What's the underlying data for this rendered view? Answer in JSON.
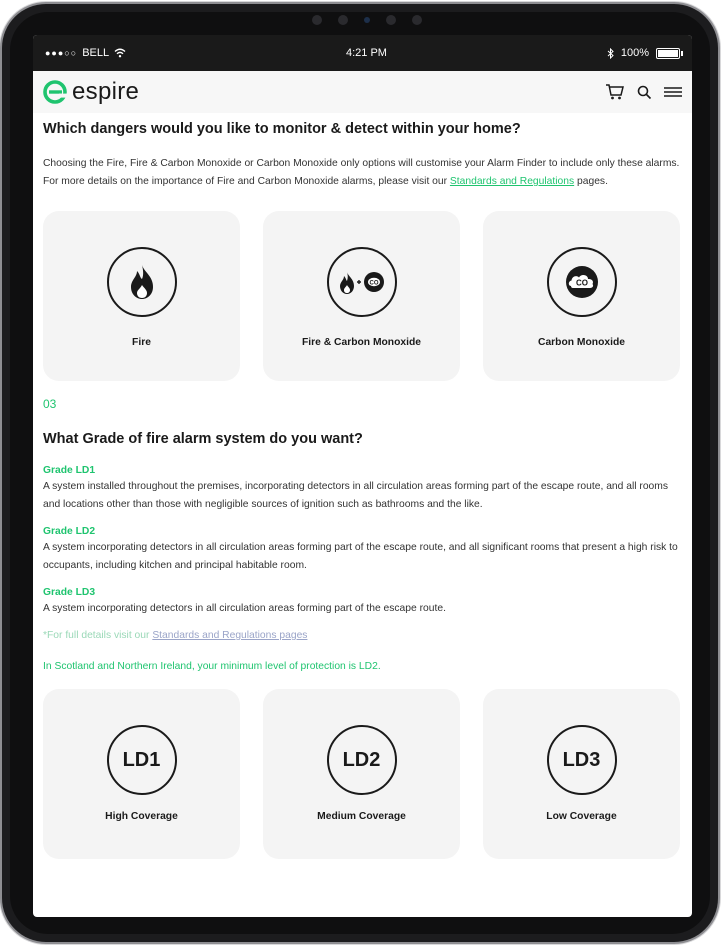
{
  "status_bar": {
    "carrier": "BELL",
    "time": "4:21 PM",
    "battery": "100%"
  },
  "nav": {
    "brand": "espire",
    "brand_color": "#1fc46f",
    "icons": [
      "cart-icon",
      "search-icon",
      "menu-icon"
    ]
  },
  "dangers": {
    "question": "Which dangers would you like to monitor & detect within your home?",
    "intro": "Choosing the Fire, Fire & Carbon Monoxide or Carbon Monoxide only options will customise your Alarm Finder to include only these alarms.  For more details on the importance of Fire and Carbon Monoxide alarms, please visit our ",
    "link": "Standards and Regulations",
    "intro_end": " pages.",
    "options": [
      {
        "label": "Fire",
        "icon": "fire-icon"
      },
      {
        "label": "Fire & Carbon Monoxide",
        "icon": "fire-co-icon"
      },
      {
        "label": "Carbon Monoxide",
        "icon": "co-cloud-icon"
      }
    ]
  },
  "grade": {
    "step": "03",
    "question": "What Grade of fire alarm system do you want?",
    "items": [
      {
        "title": "Grade LD1",
        "desc": "A system installed throughout the premises, incorporating detectors in all circulation areas forming part of the escape route, and all rooms and locations other than those with negligible sources of ignition such as bathrooms and the like."
      },
      {
        "title": "Grade LD2",
        "desc": "A system incorporating detectors in all circulation areas forming part of the escape route, and all significant rooms that present a high risk to occupants, including kitchen and principal habitable room."
      },
      {
        "title": "Grade LD3",
        "desc": "A system incorporating detectors in all circulation areas forming part of the escape route."
      }
    ],
    "note_prefix": "*For full details visit our ",
    "note_link": "Standards and Regulations pages",
    "scotland": "In Scotland and Northern Ireland, your minimum level of protection is LD2.",
    "options": [
      {
        "badge": "LD1",
        "label": "High Coverage"
      },
      {
        "badge": "LD2",
        "label": "Medium Coverage"
      },
      {
        "badge": "LD3",
        "label": "Low Coverage"
      }
    ]
  }
}
